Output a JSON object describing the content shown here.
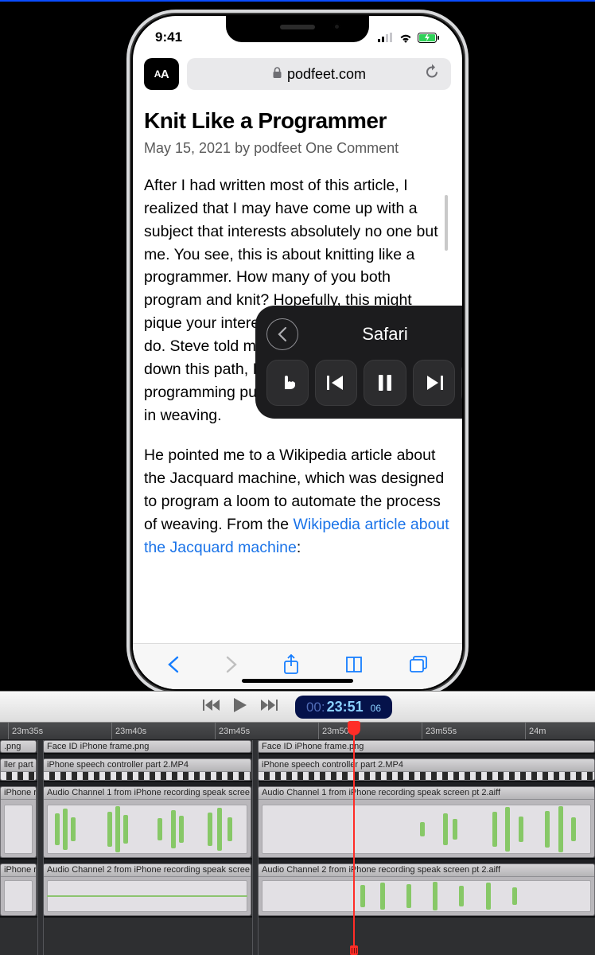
{
  "status": {
    "time": "9:41"
  },
  "browser": {
    "aa_label": "AA",
    "domain": "podfeet.com"
  },
  "article": {
    "title": "Knit Like a Programmer",
    "meta": "May 15, 2021 by podfeet One Comment",
    "p1": "After I had written most of this article, I realized that I may have come up with a subject that interests absolutely no one but me. You see, this is about knitting like a programmer. How many of you both program and knit? Hopefully, this might pique your interest in the one that you don't do. Steve told me that if I was going to go down this path, I'd better explain that programming punch cards have their origins in weaving.",
    "p2_a": "He pointed me to a Wikipedia article about the Jacquard machine, which was designed to program a loom to automate the process of weaving. From the ",
    "p2_link": "Wikipedia article about the Jacquard machine",
    "p2_b": ":"
  },
  "spoken_panel": {
    "title": "Safari"
  },
  "player": {
    "time_hh": "00:",
    "time_mmss": "23:51",
    "time_fr": "06"
  },
  "ruler": {
    "t0": "23m35s",
    "t1": "23m40s",
    "t2": "23m45s",
    "t3": "23m50s",
    "t4": "23m55s",
    "t5": "24m"
  },
  "clips": {
    "row1_a": ".png",
    "row1_b": "Face ID iPhone frame.png",
    "row1_c": "Face ID iPhone frame.png",
    "row2_a": "ller part",
    "row2_b": "iPhone speech controller part 2.MP4",
    "row2_c": "iPhone speech controller part 2.MP4",
    "row3_a": "iPhone r",
    "row3_b": "Audio Channel 1 from iPhone recording speak scree",
    "row3_c": "Audio Channel 1 from iPhone recording speak screen pt 2.aiff",
    "row4_a": "iPhone r",
    "row4_b": "Audio Channel 2 from iPhone recording speak scree",
    "row4_c": "Audio Channel 2 from iPhone recording speak screen pt 2.aiff"
  }
}
